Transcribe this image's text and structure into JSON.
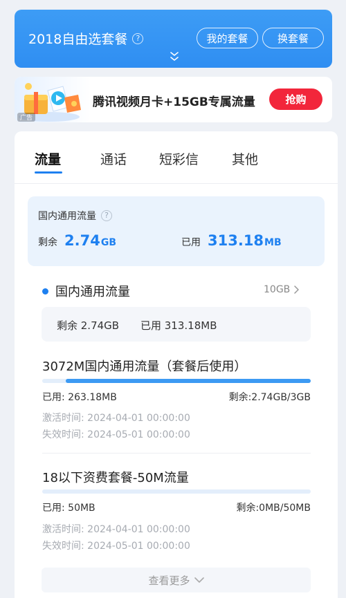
{
  "header": {
    "title": "2018自由选套餐",
    "help_symbol": "?",
    "my_plan_label": "我的套餐",
    "change_plan_label": "换套餐"
  },
  "ad": {
    "text": "腾讯视频月卡+15GB专属流量",
    "buy_label": "抢购",
    "tag": "广告"
  },
  "tabs": [
    "流量",
    "通话",
    "短彩信",
    "其他"
  ],
  "active_tab": 0,
  "summary": {
    "title": "国内通用流量",
    "help_symbol": "?",
    "remaining_label": "剩余",
    "remaining_value": "2.74",
    "remaining_unit": "GB",
    "used_label": "已用",
    "used_value": "313.18",
    "used_unit": "MB"
  },
  "section": {
    "title": "国内通用流量",
    "total": "10GB",
    "remaining_text": "剩余 2.74GB",
    "used_text": "已用 313.18MB"
  },
  "packages": [
    {
      "title": "3072M国内通用流量（套餐后使用）",
      "used": "已用: 263.18MB",
      "remaining": "剩余:2.74GB/3GB",
      "remaining_fraction": 0.913,
      "activated": "激活时间: 2024-04-01 00:00:00",
      "expires": "失效时间: 2024-05-01 00:00:00"
    },
    {
      "title": "18以下资费套餐-50M流量",
      "used": "已用: 50MB",
      "remaining": "剩余:0MB/50MB",
      "remaining_fraction": 0,
      "activated": "激活时间: 2024-04-01 00:00:00",
      "expires": "失效时间: 2024-05-01 00:00:00"
    }
  ],
  "more_label": "查看更多",
  "colors": {
    "header_blue": "#3796f4",
    "accent_blue": "#1e80f0",
    "buy_red": "#f2263b",
    "bar_fill": "#3c9af3",
    "bar_track": "#e3eefb"
  }
}
